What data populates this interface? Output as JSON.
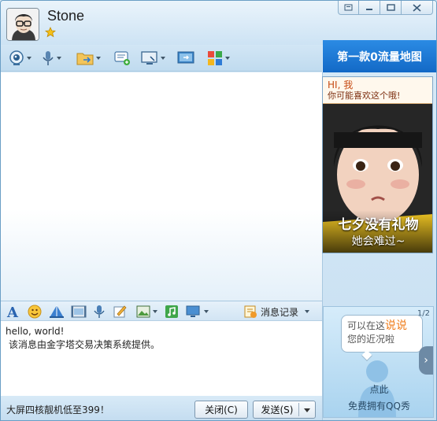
{
  "contact": {
    "name": "Stone"
  },
  "window_controls": [
    "restore",
    "minimize",
    "maximize",
    "close"
  ],
  "toolbar": {
    "items": [
      "video-call",
      "voice-call",
      "send-file",
      "send-sms",
      "remote-assist",
      "share-screen",
      "apps"
    ]
  },
  "banner": {
    "text": "第一款0流量地图"
  },
  "ad_top": {
    "greeting": "HI, 我",
    "subtitle": "你可能喜欢这个哦!",
    "headline": "七夕没有礼物",
    "tagline": "她会难过~"
  },
  "format_toolbar": {
    "history_label": "消息记录"
  },
  "input": {
    "line1": "hello, world!",
    "line2": "该消息由金字塔交易决策系统提供。"
  },
  "bottom": {
    "promo": "大屏四核靓机低至399！",
    "close_label": "关闭(C)",
    "send_label": "发送(S)"
  },
  "ad_bottom": {
    "page": "1/2",
    "bubble_prefix": "可以在这",
    "bubble_highlight": "说说",
    "bubble_line2": "您的近况啦",
    "cta1": "点此",
    "cta2": "免费拥有QQ秀"
  },
  "colors": {
    "banner_blue": "#1f7ad6",
    "accent_orange": "#ef7c1a",
    "frame": "#6a9ec5"
  }
}
